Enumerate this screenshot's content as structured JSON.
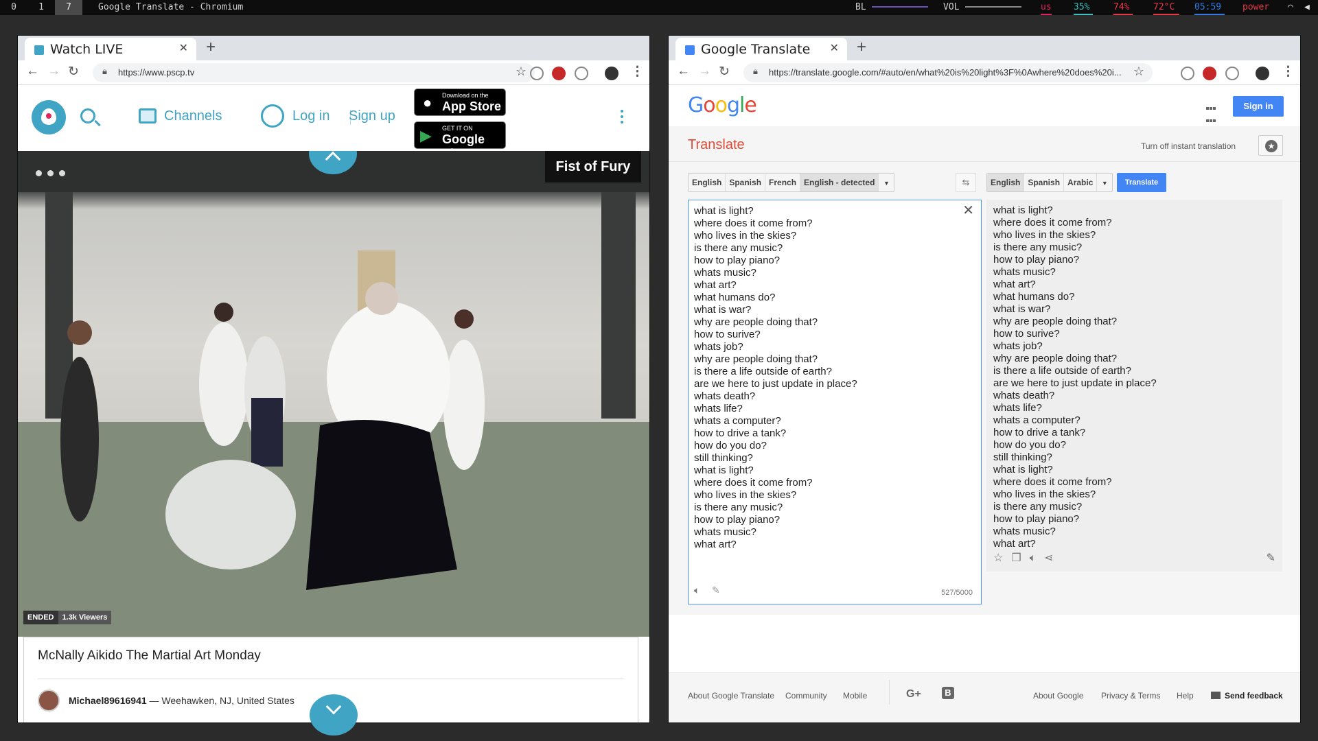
{
  "topbar": {
    "workspaces": [
      "0",
      "1",
      "7"
    ],
    "active_workspace": "7",
    "window_title": "Google Translate - Chromium",
    "status": {
      "bl": "BL",
      "vol": "VOL",
      "us": "us",
      "cpu": "35%",
      "mem": "74%",
      "temp": "72°C",
      "time": "05:59",
      "power": "power"
    },
    "status_colors": {
      "us": "#e0245e",
      "cpu": "#3cbfbf",
      "mem": "#e8394a",
      "temp": "#e8394a",
      "time": "#2f7de1",
      "power": "#e8394a"
    }
  },
  "left_window": {
    "tab_title": "Watch LIVE",
    "url": "https://www.pscp.tv",
    "nav": {
      "channels": "Channels",
      "login": "Log in",
      "signup": "Sign up"
    },
    "stores": {
      "apple_small": "Download on the",
      "apple_big": "App Store",
      "google_small": "GET IT ON",
      "google_big": "Google Play"
    },
    "video": {
      "label": "Fist of Fury",
      "ended": "ENDED",
      "viewers": "1.3k Viewers"
    },
    "broadcast": {
      "title": "McNally Aikido The Martial Art Monday",
      "user": "Michael89616941",
      "location": "— Weehawken, NJ, United States"
    }
  },
  "right_window": {
    "tab_title": "Google Translate",
    "url": "https://translate.google.com/#auto/en/what%20is%20light%3F%0Awhere%20does%20i...",
    "header": {
      "sign_in": "Sign in"
    },
    "subheader": {
      "translate": "Translate",
      "instant": "Turn off instant translation"
    },
    "source_langs": [
      "English",
      "Spanish",
      "French",
      "English - detected"
    ],
    "target_langs": [
      "English",
      "Spanish",
      "Arabic"
    ],
    "translate_button": "Translate",
    "source_text": "what is light?\nwhere does it come from?\nwho lives in the skies?\nis there any music?\nhow to play piano?\nwhats music?\nwhat art?\nwhat humans do?\nwhat is war?\nwhy are people doing that?\nhow to surive?\nwhats job?\nwhy are people doing that?\nis there a life outside of earth?\nare we here to just update in place?\nwhats death?\nwhats life?\nwhats a computer?\nhow to drive a tank?\nhow do you do?\nstill thinking?\nwhat is light?\nwhere does it come from?\nwho lives in the skies?\nis there any music?\nhow to play piano?\nwhats music?\nwhat art?",
    "char_count": "527/5000",
    "footer": {
      "about_translate": "About Google Translate",
      "community": "Community",
      "mobile": "Mobile",
      "about_google": "About Google",
      "privacy": "Privacy & Terms",
      "help": "Help",
      "feedback": "Send feedback"
    }
  }
}
